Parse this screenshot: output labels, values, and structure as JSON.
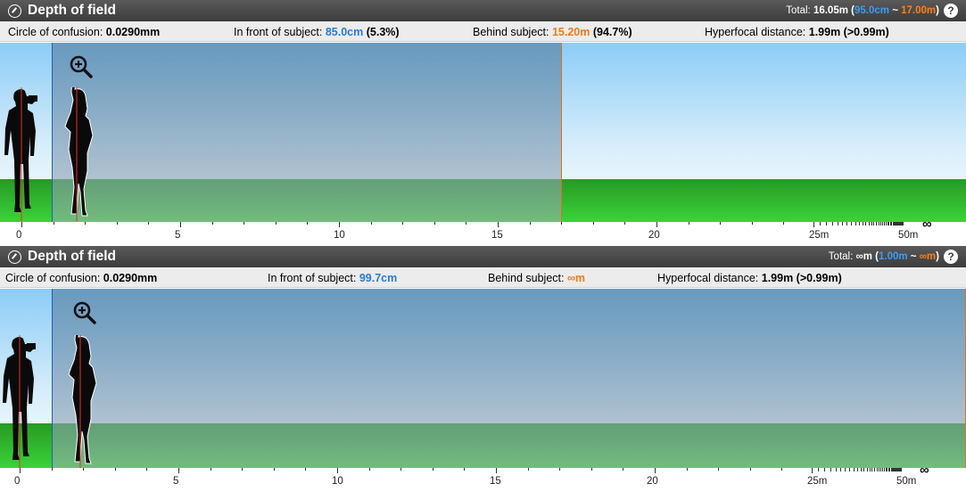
{
  "panels": [
    {
      "title": "Depth of field",
      "total_label": "Total:",
      "total_value": "16.05m",
      "total_open": "(",
      "total_near": "95.0cm",
      "total_sep": "~",
      "total_far": "17.00m",
      "total_close": ")",
      "info": {
        "coc_label": "Circle of confusion:",
        "coc_value": "0.0290mm",
        "front_label": "In front of subject:",
        "front_value": "85.0cm",
        "front_pct": "(5.3%)",
        "behind_label": "Behind subject:",
        "behind_value": "15.20m",
        "behind_pct": "(94.7%)",
        "hyper_label": "Hyperfocal distance:",
        "hyper_value": "1.99m (>0.99m)"
      },
      "scene": {
        "subject_distance_m": 1.8,
        "near_limit_m": 0.95,
        "far_limit_m": 17.0
      }
    },
    {
      "title": "Depth of field",
      "total_label": "Total:",
      "total_value": "∞m",
      "total_open": "(",
      "total_near": "1.00m",
      "total_sep": "~",
      "total_far": "∞m",
      "total_close": ")",
      "info": {
        "coc_label": "Circle of confusion:",
        "coc_value": "0.0290mm",
        "front_label": "In front of subject:",
        "front_value": "99.7cm",
        "front_pct": "",
        "behind_label": "Behind subject:",
        "behind_value": "∞m",
        "behind_pct": "",
        "hyper_label": "Hyperfocal distance:",
        "hyper_value": "1.99m (>0.99m)"
      },
      "scene": {
        "subject_distance_m": 1.99,
        "near_limit_m": 1.0,
        "far_limit_m": "infinity"
      }
    }
  ],
  "ruler": {
    "labels": [
      "0",
      "5",
      "10",
      "15",
      "20",
      "25m",
      "50m"
    ],
    "infinity": "∞"
  },
  "icons": [
    "aperture-icon",
    "help-icon",
    "zoom-in-icon",
    "photographer-silhouette",
    "subject-silhouette"
  ],
  "colors": {
    "near_limit": "#2a7bd4",
    "far_limit": "#ef7a1a",
    "ground": "#2fb52a",
    "sky": "#a8dbfb"
  }
}
